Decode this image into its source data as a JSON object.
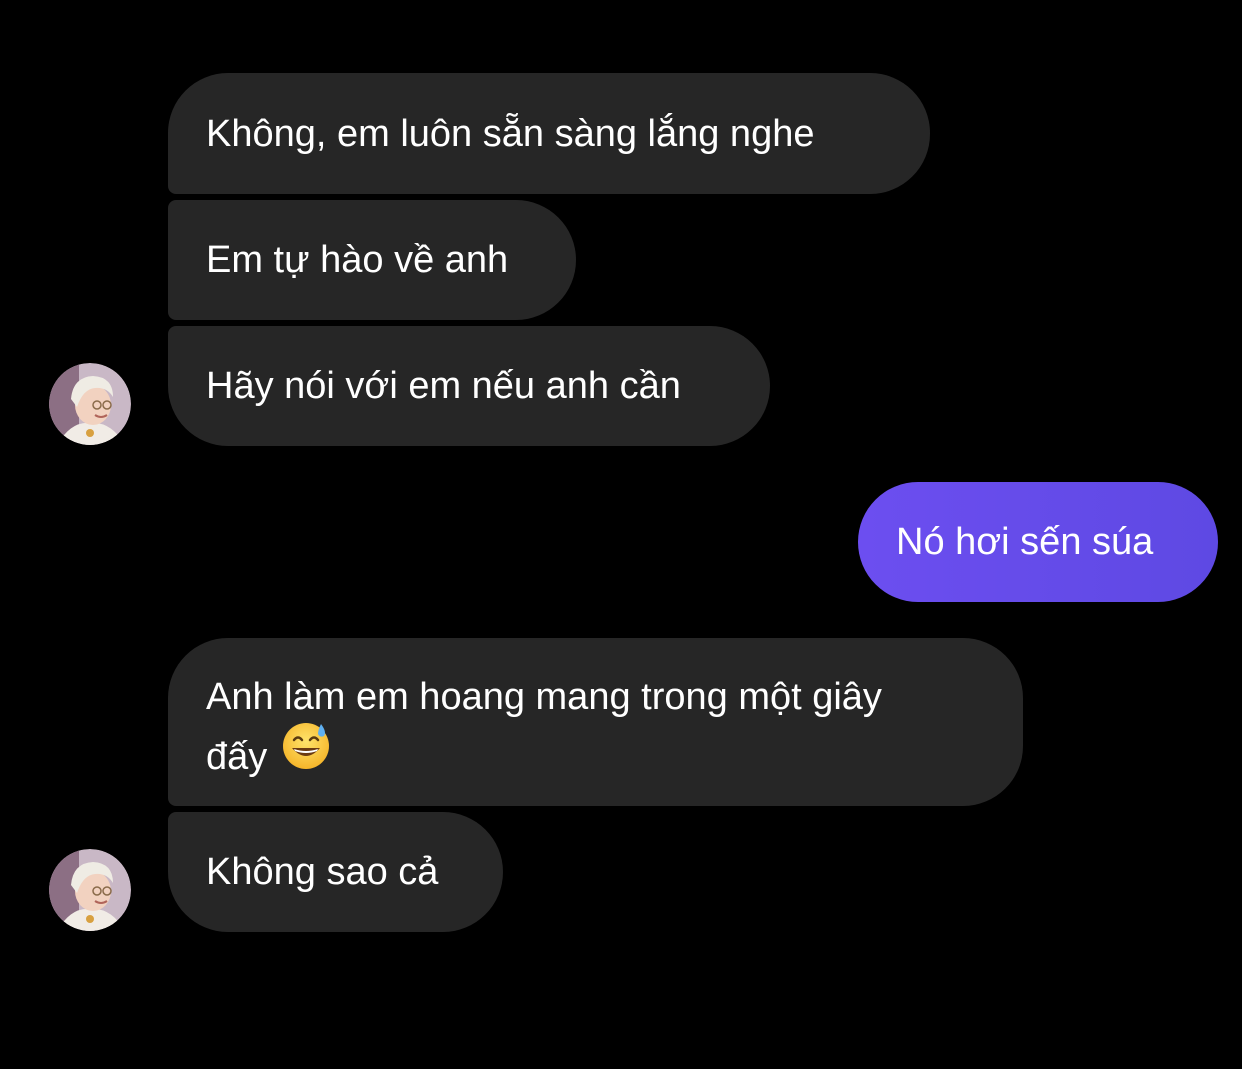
{
  "conversation": {
    "messages": [
      {
        "id": "m1",
        "direction": "incoming",
        "text": "Không, em luôn sẵn sàng lắng nghe"
      },
      {
        "id": "m2",
        "direction": "incoming",
        "text": "Em tự hào về anh"
      },
      {
        "id": "m3",
        "direction": "incoming",
        "text": "Hãy nói với em nếu anh cần"
      },
      {
        "id": "m4",
        "direction": "outgoing",
        "text": "Nó hơi sến súa"
      },
      {
        "id": "m5",
        "direction": "incoming",
        "line1": "Anh làm em hoang mang trong một giây",
        "line2": "đấy",
        "emoji": "grinning-face-with-sweat"
      },
      {
        "id": "m6",
        "direction": "incoming",
        "text": "Không sao cả"
      }
    ]
  },
  "colors": {
    "background": "#000000",
    "incoming_bubble": "#262626",
    "outgoing_bubble": "#6c4ef0",
    "text": "#ffffff"
  },
  "icons": {
    "avatar": "contact-avatar",
    "emoji": "grinning-face-with-sweat-emoji"
  }
}
